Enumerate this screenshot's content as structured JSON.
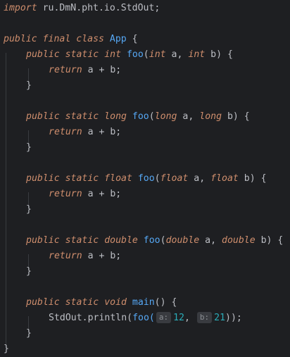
{
  "code": {
    "import_kw": "import",
    "import_path": "ru.DmN.pht.io.StdOut;",
    "public": "public",
    "final": "final",
    "class": "class",
    "class_name": "App",
    "static": "static",
    "return": "return",
    "fn_name": "foo",
    "main_name": "main",
    "void": "void",
    "types": [
      "int",
      "long",
      "float",
      "double"
    ],
    "return_expr": "a + b;",
    "stdout_call": "StdOut.println(",
    "foo_call": "foo(",
    "hint_a": "a:",
    "hint_b": "b:",
    "arg1": "12",
    "arg2": "21",
    "call_close": "));",
    "param_a": "a",
    "param_b": "b"
  },
  "colors": {
    "background": "#1e1f22",
    "keyword": "#cf8e6d",
    "function": "#56a8f5",
    "number": "#2aacb8",
    "text": "#bcbec4",
    "hint_bg": "#393b40"
  }
}
